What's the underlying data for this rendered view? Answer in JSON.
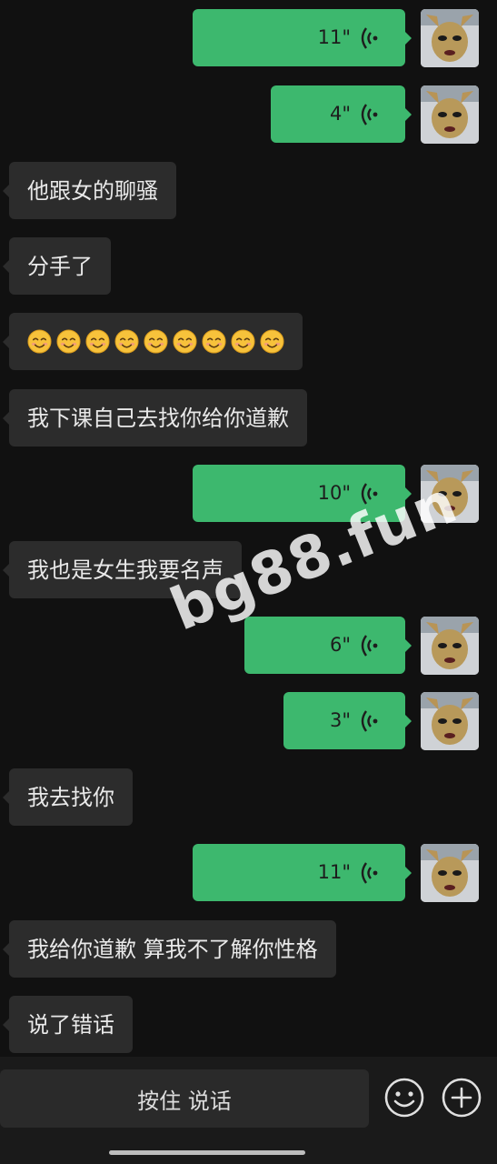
{
  "colors": {
    "background": "#111111",
    "incoming_bubble": "#2c2c2c",
    "outgoing_bubble": "#3db86e",
    "bottom_bar": "#1a1a1a"
  },
  "messages": [
    {
      "side": "out",
      "type": "voice",
      "duration": "11\""
    },
    {
      "side": "out",
      "type": "voice",
      "duration": "4\""
    },
    {
      "side": "in",
      "type": "text",
      "text": "他跟女的聊骚"
    },
    {
      "side": "in",
      "type": "text",
      "text": "分手了"
    },
    {
      "side": "in",
      "type": "emoji",
      "emoji": "smiling-face-icon",
      "count": 9
    },
    {
      "side": "in",
      "type": "text",
      "text": "我下课自己去找你给你道歉"
    },
    {
      "side": "out",
      "type": "voice",
      "duration": "10\""
    },
    {
      "side": "in",
      "type": "text",
      "text": "我也是女生我要名声"
    },
    {
      "side": "out",
      "type": "voice",
      "duration": "6\""
    },
    {
      "side": "out",
      "type": "voice",
      "duration": "3\""
    },
    {
      "side": "in",
      "type": "text",
      "text": "我去找你"
    },
    {
      "side": "out",
      "type": "voice",
      "duration": "11\""
    },
    {
      "side": "in",
      "type": "text",
      "text": "我给你道歉 算我不了解你性格"
    },
    {
      "side": "in",
      "type": "text",
      "text": "说了错话"
    }
  ],
  "watermark": "bg88.fun",
  "input_bar": {
    "hold_to_talk_label": "按住 说话",
    "emoji_button_icon": "smiley-icon",
    "plus_button_icon": "plus-circle-icon"
  }
}
